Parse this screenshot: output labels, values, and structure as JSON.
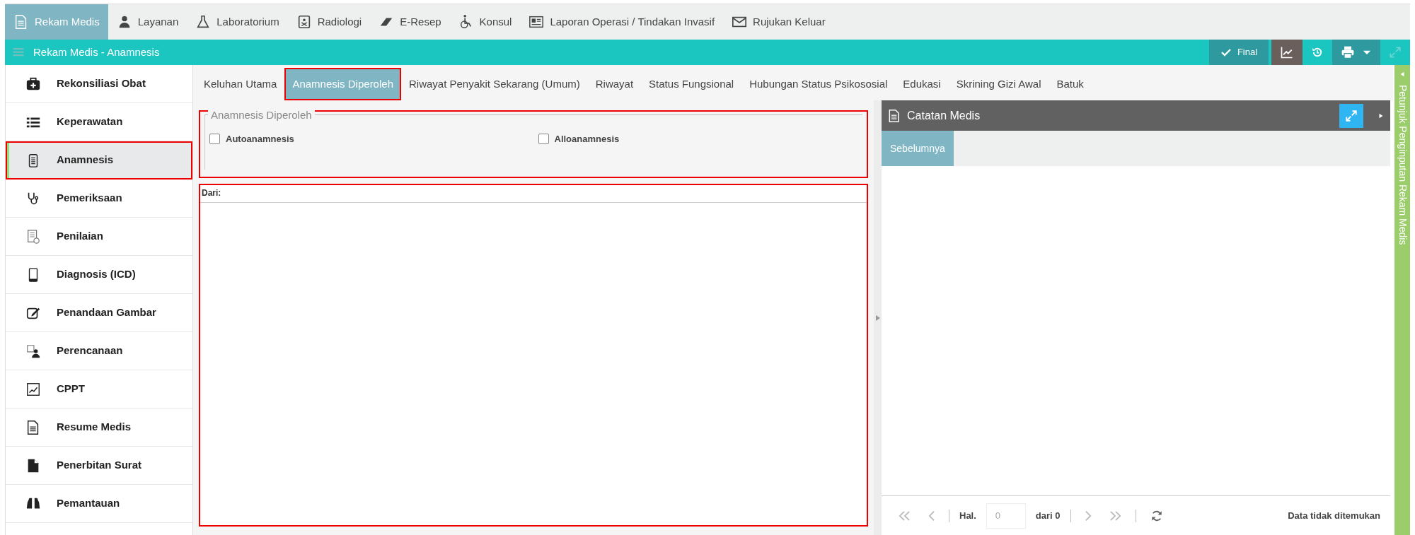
{
  "top_nav": [
    {
      "label": "Rekam Medis",
      "kind": "document",
      "selected": true
    },
    {
      "label": "Layanan",
      "kind": "doctor",
      "selected": false
    },
    {
      "label": "Laboratorium",
      "kind": "flask",
      "selected": false
    },
    {
      "label": "Radiologi",
      "kind": "xray",
      "selected": false
    },
    {
      "label": "E-Resep",
      "kind": "eraser",
      "selected": false
    },
    {
      "label": "Konsul",
      "kind": "wheelchair",
      "selected": false
    },
    {
      "label": "Laporan Operasi / Tindakan Invasif",
      "kind": "newspaper",
      "selected": false
    },
    {
      "label": "Rujukan Keluar",
      "kind": "envelope",
      "selected": false
    }
  ],
  "title_bar": {
    "title": "Rekam Medis - Anamnesis",
    "final_label": "Final"
  },
  "sidebar": {
    "items": [
      {
        "label": "Rekonsiliasi Obat",
        "kind": "medkit",
        "selected": false,
        "highlighted": false
      },
      {
        "label": "Keperawatan",
        "kind": "list",
        "selected": false,
        "highlighted": false
      },
      {
        "label": "Anamnesis",
        "kind": "clipboard",
        "selected": true,
        "highlighted": true
      },
      {
        "label": "Pemeriksaan",
        "kind": "stethoscope",
        "selected": false,
        "highlighted": false
      },
      {
        "label": "Penilaian",
        "kind": "checkdoc",
        "selected": false,
        "highlighted": false
      },
      {
        "label": "Diagnosis (ICD)",
        "kind": "phone",
        "selected": false,
        "highlighted": false
      },
      {
        "label": "Penandaan Gambar",
        "kind": "edit",
        "selected": false,
        "highlighted": false
      },
      {
        "label": "Perencanaan",
        "kind": "person",
        "selected": false,
        "highlighted": false
      },
      {
        "label": "CPPT",
        "kind": "chart",
        "selected": false,
        "highlighted": false
      },
      {
        "label": "Resume Medis",
        "kind": "document",
        "selected": false,
        "highlighted": false
      },
      {
        "label": "Penerbitan Surat",
        "kind": "file",
        "selected": false,
        "highlighted": false
      },
      {
        "label": "Pemantauan",
        "kind": "binoculars",
        "selected": false,
        "highlighted": false
      }
    ]
  },
  "tabs": [
    {
      "label": "Keluhan Utama",
      "selected": false,
      "highlighted": false
    },
    {
      "label": "Anamnesis Diperoleh",
      "selected": true,
      "highlighted": true
    },
    {
      "label": "Riwayat Penyakit Sekarang (Umum)",
      "selected": false,
      "highlighted": false
    },
    {
      "label": "Riwayat",
      "selected": false,
      "highlighted": false
    },
    {
      "label": "Status Fungsional",
      "selected": false,
      "highlighted": false
    },
    {
      "label": "Hubungan Status Psikososial",
      "selected": false,
      "highlighted": false
    },
    {
      "label": "Edukasi",
      "selected": false,
      "highlighted": false
    },
    {
      "label": "Skrining Gizi Awal",
      "selected": false,
      "highlighted": false
    },
    {
      "label": "Batuk",
      "selected": false,
      "highlighted": false
    }
  ],
  "fieldset": {
    "legend": "Anamnesis Diperoleh",
    "highlighted": true,
    "options": [
      {
        "label": "Autoanamnesis",
        "checked": false
      },
      {
        "label": "Alloanamnesis",
        "checked": false
      }
    ]
  },
  "source_panel": {
    "label": "Dari:",
    "highlighted": true
  },
  "notes_panel": {
    "title": "Catatan Medis",
    "tabs": [
      {
        "label": "Sebelumnya",
        "selected": true
      }
    ],
    "pager": {
      "page_label": "Hal.",
      "page_value": "0",
      "of_label": "dari 0",
      "status": "Data tidak ditemukan"
    }
  },
  "guide_strip": {
    "label": "Petunjuk Penginputan Rekam Medis"
  }
}
